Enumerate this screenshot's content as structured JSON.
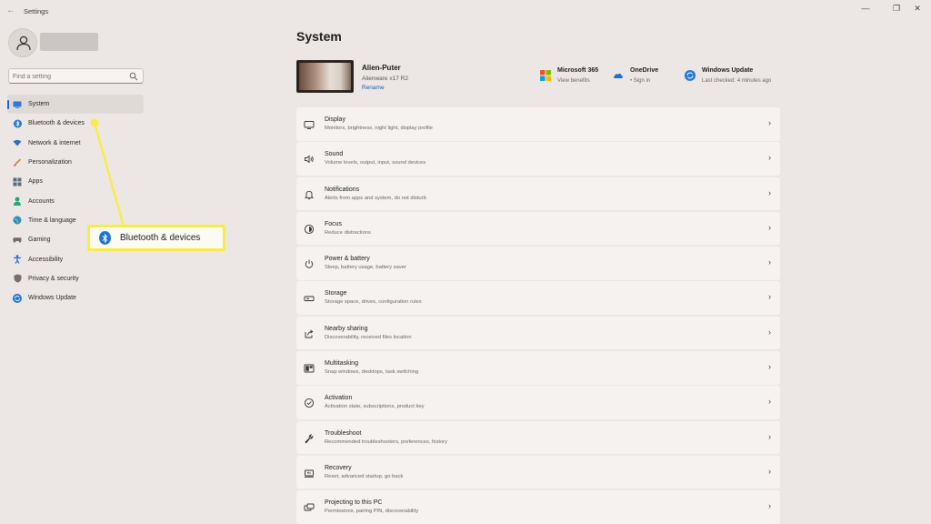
{
  "window": {
    "title": "Settings",
    "back": "←",
    "minimize": "—",
    "maximize": "❐",
    "close": "✕"
  },
  "search": {
    "placeholder": "Find a setting"
  },
  "sidebar": {
    "items": [
      {
        "label": "System",
        "icon": "system-icon",
        "color": "#2b7bd6",
        "selected": true
      },
      {
        "label": "Bluetooth & devices",
        "icon": "bluetooth-icon",
        "color": "#1b74d6"
      },
      {
        "label": "Network & internet",
        "icon": "wifi-icon",
        "color": "#2d6cc4"
      },
      {
        "label": "Personalization",
        "icon": "brush-icon",
        "color": "#c58a3e"
      },
      {
        "label": "Apps",
        "icon": "apps-icon",
        "color": "#5b6a80"
      },
      {
        "label": "Accounts",
        "icon": "account-icon",
        "color": "#2aa37a"
      },
      {
        "label": "Time & language",
        "icon": "globe-icon",
        "color": "#2a8fc9"
      },
      {
        "label": "Gaming",
        "icon": "gamepad-icon",
        "color": "#6b6b6b"
      },
      {
        "label": "Accessibility",
        "icon": "accessibility-icon",
        "color": "#2f6fd0"
      },
      {
        "label": "Privacy & security",
        "icon": "shield-icon",
        "color": "#707070"
      },
      {
        "label": "Windows Update",
        "icon": "update-icon",
        "color": "#1f78d1"
      }
    ]
  },
  "callout": {
    "label": "Bluetooth & devices",
    "highlight_color": "#f7ec4a"
  },
  "main": {
    "title": "System",
    "device": {
      "name": "Alien-Puter",
      "model": "Alienware x17 R2",
      "rename": "Rename"
    },
    "quick_links": [
      {
        "title": "Microsoft 365",
        "sub": "View benefits",
        "icon": "microsoft-logo-icon"
      },
      {
        "title": "OneDrive",
        "sub": "• Sign in",
        "icon": "onedrive-icon"
      },
      {
        "title": "Windows Update",
        "sub": "Last checked: 4 minutes ago",
        "icon": "update-icon"
      }
    ],
    "settings": [
      {
        "title": "Display",
        "sub": "Monitors, brightness, night light, display profile",
        "icon": "display-icon"
      },
      {
        "title": "Sound",
        "sub": "Volume levels, output, input, sound devices",
        "icon": "speaker-icon"
      },
      {
        "title": "Notifications",
        "sub": "Alerts from apps and system, do not disturb",
        "icon": "bell-icon"
      },
      {
        "title": "Focus",
        "sub": "Reduce distractions",
        "icon": "focus-icon"
      },
      {
        "title": "Power & battery",
        "sub": "Sleep, battery usage, battery saver",
        "icon": "power-icon"
      },
      {
        "title": "Storage",
        "sub": "Storage space, drives, configuration rules",
        "icon": "storage-icon"
      },
      {
        "title": "Nearby sharing",
        "sub": "Discoverability, received files location",
        "icon": "share-icon"
      },
      {
        "title": "Multitasking",
        "sub": "Snap windows, desktops, task switching",
        "icon": "multitasking-icon"
      },
      {
        "title": "Activation",
        "sub": "Activation state, subscriptions, product key",
        "icon": "activation-icon"
      },
      {
        "title": "Troubleshoot",
        "sub": "Recommended troubleshooters, preferences, history",
        "icon": "wrench-icon"
      },
      {
        "title": "Recovery",
        "sub": "Reset, advanced startup, go back",
        "icon": "recovery-icon"
      },
      {
        "title": "Projecting to this PC",
        "sub": "Permissions, pairing PIN, discoverability",
        "icon": "projecting-icon"
      }
    ],
    "chevron": "›"
  },
  "colors": {
    "accent": "#1a66c4",
    "background": "#ece7e4",
    "card": "#f5f2f0"
  }
}
